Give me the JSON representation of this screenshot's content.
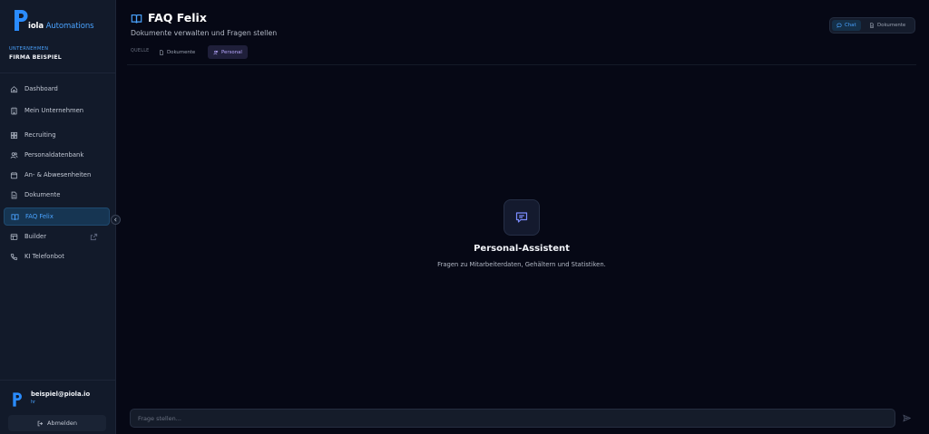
{
  "brand": {
    "logo_letter": "P",
    "name_part1": "iola",
    "name_part2": "Automations"
  },
  "company": {
    "label": "UNTERNEHMEN",
    "name": "FIRMA BEISPIEL"
  },
  "nav": {
    "dashboard": "Dashboard",
    "company": "Mein Unternehmen",
    "recruiting": "Recruiting",
    "personnel_db": "Personaldatenbank",
    "attendance": "An- & Abwesenheiten",
    "documents": "Dokumente",
    "faq": "FAQ Felix",
    "builder": "Builder",
    "phone_bot": "KI Telefonbot"
  },
  "user": {
    "email": "beispiel@piola.io",
    "role": "hr"
  },
  "logout_label": "Abmelden",
  "page": {
    "title": "FAQ Felix",
    "subtitle": "Dokumente verwalten und Fragen stellen"
  },
  "source": {
    "label": "QUELLE",
    "documents": "Dokumente",
    "personnel": "Personal"
  },
  "view_toggle": {
    "chat": "Chat",
    "documents": "Dokumente"
  },
  "empty_state": {
    "title": "Personal-Assistent",
    "description": "Fragen zu Mitarbeiterdaten, Gehältern und Statistiken."
  },
  "input": {
    "placeholder": "Frage stellen..."
  },
  "colors": {
    "accent": "#4aa3ff",
    "accent_violet": "#b8a8ff",
    "background": "#060815",
    "sidebar": "#121a2a"
  }
}
